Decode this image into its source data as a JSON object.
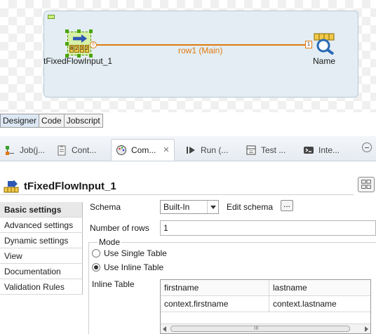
{
  "canvas": {
    "source_component": "tFixedFlowInput_1",
    "source_digits": [
      "8",
      "2",
      "3",
      "2"
    ],
    "target_component": "Name",
    "link_label": "row1 (Main)",
    "link_start_marker": "0",
    "link_end_marker": "1",
    "link_color": "#e07a10"
  },
  "editor_tabs": [
    "Designer",
    "Code",
    "Jobscript"
  ],
  "view_tabs": [
    {
      "label": "Job(j...",
      "icon": "job-icon"
    },
    {
      "label": "Cont...",
      "icon": "contexts-icon"
    },
    {
      "label": "Com...",
      "icon": "component-icon"
    },
    {
      "label": "Run (...",
      "icon": "run-icon"
    },
    {
      "label": "Test ...",
      "icon": "test-icon"
    },
    {
      "label": "Inte...",
      "icon": "interpreter-icon"
    }
  ],
  "component": {
    "title": "tFixedFlowInput_1"
  },
  "settings_nav": [
    "Basic settings",
    "Advanced settings",
    "Dynamic settings",
    "View",
    "Documentation",
    "Validation Rules"
  ],
  "form": {
    "schema_label": "Schema",
    "schema_value": "Built-In",
    "edit_schema_label": "Edit schema",
    "edit_schema_button": "...",
    "rows_label": "Number of rows",
    "rows_value": "1",
    "mode_label": "Mode",
    "mode_single": "Use Single Table",
    "mode_inline": "Use Inline Table",
    "mode_selected": "Use Inline Table",
    "inline_table_label": "Inline Table",
    "table": {
      "columns": [
        "firstname",
        "lastname"
      ],
      "rows": [
        [
          "context.firstname",
          "context.lastname"
        ]
      ]
    },
    "scrollbar_grip": "III"
  }
}
